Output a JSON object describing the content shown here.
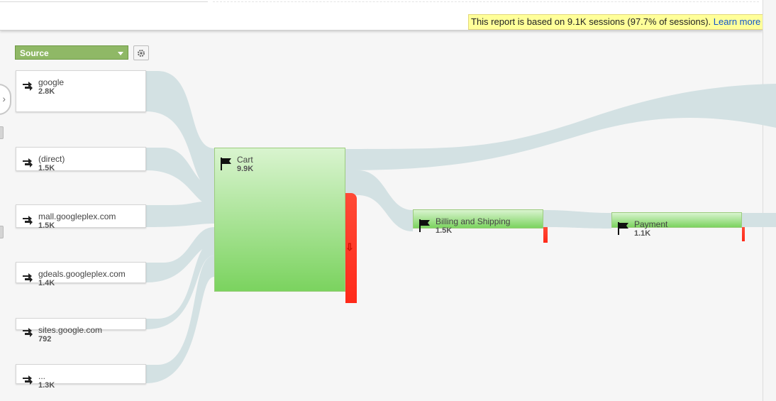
{
  "notice": {
    "text": "This report is based on 9.1K sessions (97.7% of sessions).",
    "link": "Learn more"
  },
  "controls": {
    "dimension_label": "Source",
    "settings_icon": "gear-icon",
    "expand_icon": "chevron-right-icon",
    "expand_glyph": "›"
  },
  "sources": [
    {
      "name": "google",
      "count": "2.8K"
    },
    {
      "name": "(direct)",
      "count": "1.5K"
    },
    {
      "name": "mall.googleplex.com",
      "count": "1.5K"
    },
    {
      "name": "gdeals.googleplex.com",
      "count": "1.4K"
    },
    {
      "name": "sites.google.com",
      "count": "792"
    },
    {
      "name": "...",
      "count": "1.3K"
    }
  ],
  "steps": [
    {
      "name": "Cart",
      "count": "9.9K"
    },
    {
      "name": "Billing and Shipping",
      "count": "1.5K"
    },
    {
      "name": "Payment",
      "count": "1.1K"
    }
  ],
  "drop_arrow": "⇩",
  "colors": {
    "flow": "#d3e1e3",
    "node_top": "#d9f4cf",
    "node_bottom": "#7bd35f",
    "dropoff": "#ff3b2a",
    "dimension_bg": "#8fb866",
    "notice_bg": "#ffff99"
  }
}
